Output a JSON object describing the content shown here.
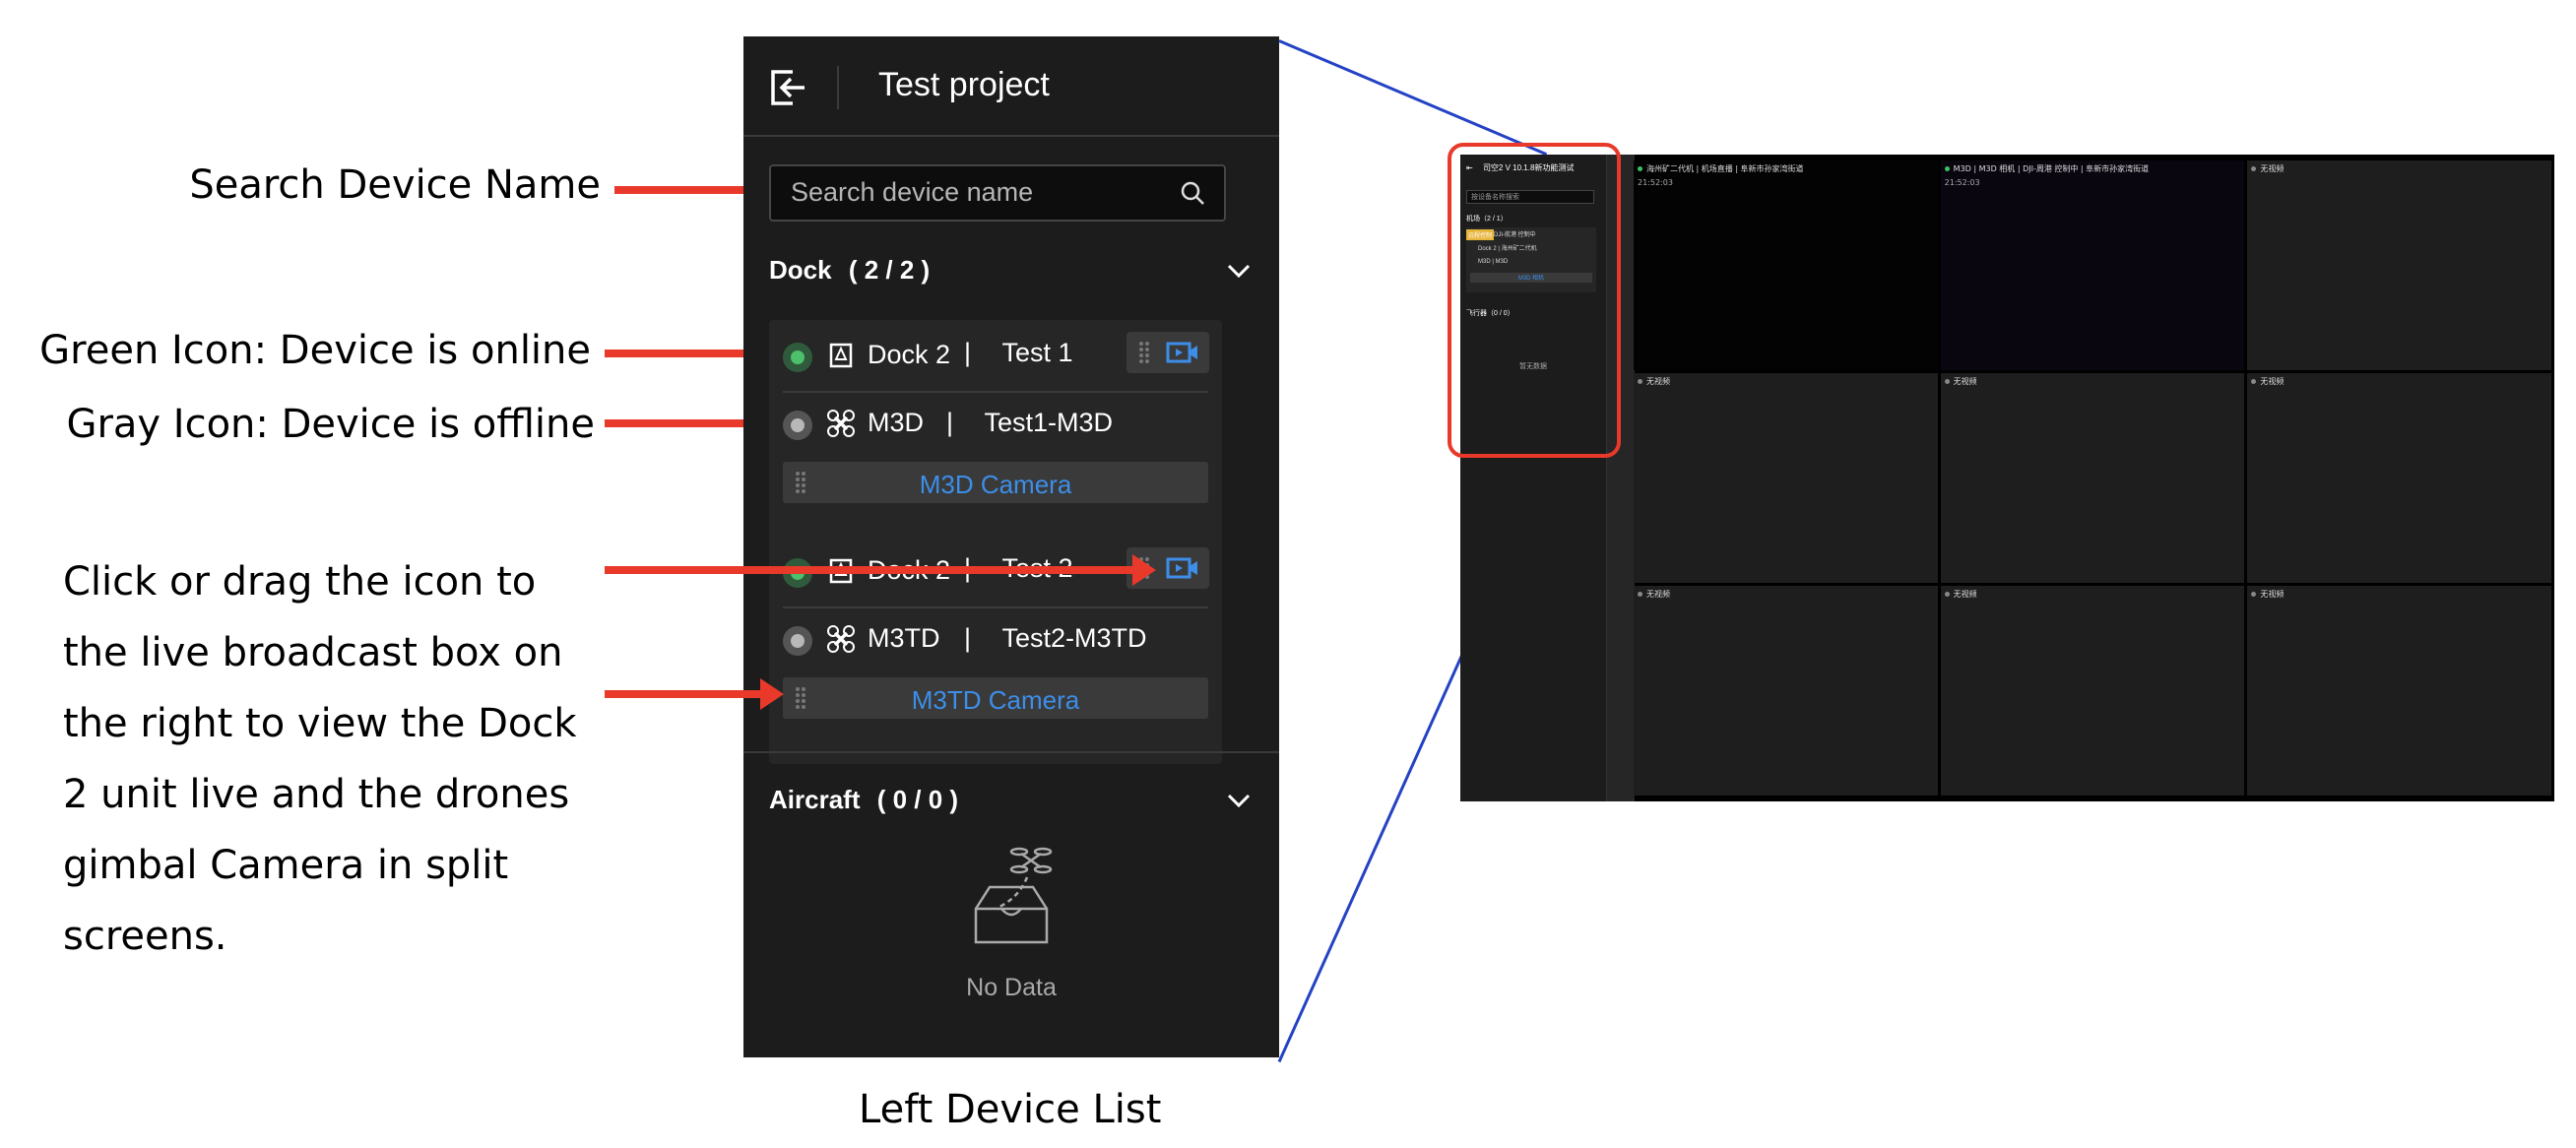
{
  "annotations": {
    "search": "Search Device Name",
    "online": "Green Icon: Device is online",
    "offline": "Gray Icon: Device is offline",
    "instruction_lines": [
      "Click or drag the icon to",
      "the live broadcast box on",
      "the right to view the Dock",
      "2 unit live and the drones",
      "gimbal Camera in split",
      "screens."
    ],
    "caption": "Left Device List"
  },
  "panel": {
    "title": "Test project",
    "search_placeholder": "Search device name",
    "dock_section": {
      "label": "Dock",
      "count": "( 2 / 2 )"
    },
    "groups": [
      {
        "dock": {
          "model": "Dock 2",
          "name": "Test 1",
          "status": "online"
        },
        "drone": {
          "model": "M3D",
          "name": "Test1-M3D",
          "status": "offline"
        },
        "camera_label": "M3D Camera"
      },
      {
        "dock": {
          "model": "Dock 2",
          "name": "Test 2",
          "status": "online"
        },
        "drone": {
          "model": "M3TD",
          "name": "Test2-M3TD",
          "status": "offline"
        },
        "camera_label": "M3TD Camera"
      }
    ],
    "aircraft_section": {
      "label": "Aircraft",
      "count": "( 0 / 0 )"
    },
    "empty_label": "No Data"
  },
  "screenshot": {
    "title": "司空2 V 10.1.8新功能测试",
    "search_placeholder": "按设备名称搜索",
    "dock_section": "机场（2 / 1）",
    "badge": "远程控制",
    "badge_text": "DJI-航港 控制中",
    "dock_row": "Dock 2 | 海州矿二代机",
    "drone_row": "M3D | M3D",
    "camera_label": "M3D 相机",
    "aircraft_section": "飞行器（0 / 0）",
    "empty_label": "暂无数据",
    "cells": [
      {
        "label": "海州矿二代机 | 机场直播 | 阜新市孙家湾街道",
        "time": "21:52:03",
        "live": true
      },
      {
        "label": "M3D | M3D 相机 | DJI-周港 控制中 | 阜新市孙家湾街道",
        "time": "21:52:03",
        "live": true
      },
      {
        "label": "无视频",
        "time": "",
        "live": false
      },
      {
        "label": "无视频",
        "time": "",
        "live": false
      },
      {
        "label": "无视频",
        "time": "",
        "live": false
      },
      {
        "label": "无视频",
        "time": "",
        "live": false
      },
      {
        "label": "无视频",
        "time": "",
        "live": false
      },
      {
        "label": "无视频",
        "time": "",
        "live": false
      },
      {
        "label": "无视频",
        "time": "",
        "live": false
      }
    ]
  },
  "colors": {
    "online": "#4cc06a",
    "offline": "#b8b8b8",
    "accent": "#3d8ee8",
    "annotation_arrow": "#e8392a",
    "connector": "#2442c5"
  }
}
